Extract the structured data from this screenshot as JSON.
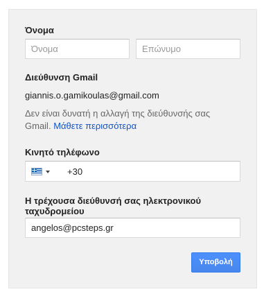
{
  "form": {
    "name": {
      "label": "Όνομα",
      "first_placeholder": "Όνομα",
      "last_placeholder": "Επώνυμο",
      "first_value": "",
      "last_value": ""
    },
    "gmail": {
      "label": "Διεύθυνση Gmail",
      "address": "giannis.o.gamikoulas@gmail.com",
      "hint": "Δεν είναι δυνατή η αλλαγή της διεύθυνσής σας Gmail.",
      "learn_more": "Μάθετε περισσότερα"
    },
    "phone": {
      "label": "Κινητό τηλέφωνο",
      "country_flag_icon": "greece-flag-icon",
      "value": "+30"
    },
    "current_email": {
      "label": "Η τρέχουσα διεύθυνσή σας ηλεκτρονικού ταχυδρομείου",
      "value": "angelos@pcsteps.gr"
    },
    "submit_label": "Υποβολή"
  },
  "colors": {
    "panel_bg": "#f1f1f1",
    "link": "#1155cc",
    "button": "#4d90fe"
  }
}
